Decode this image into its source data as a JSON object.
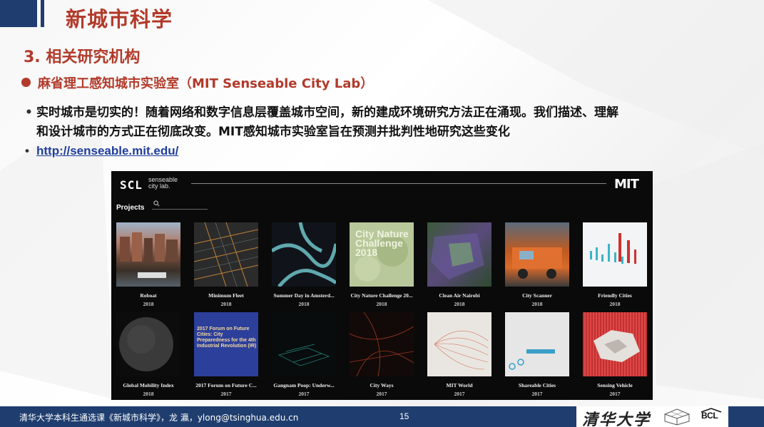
{
  "slide": {
    "title": "新城市科学",
    "section": "3. 相关研究机构",
    "subheading": "麻省理工感知城市实验室（MIT Senseable City Lab）",
    "bullet1_line1": "实时城市是切实的！随着网络和数字信息层覆盖城市空间，新的建成环境研究方法正在涌现。我们描述、理解",
    "bullet1_line2": "和设计城市的方式正在彻底改变。MIT感知城市实验室旨在预测并批判性地研究这些变化",
    "link": "http://senseable.mit.edu/",
    "bullet_mark": "•"
  },
  "embedded_site": {
    "logo": "SCL",
    "name_line1": "senseable",
    "name_line2": "city lab.",
    "mit_logo": "MIT",
    "projects_label": "Projects",
    "search_icon": "search-icon",
    "projects": [
      {
        "title": "Roboat",
        "year": "2018"
      },
      {
        "title": "Minimum Fleet",
        "year": "2018"
      },
      {
        "title": "Summer Day in Amsterd...",
        "year": "2018"
      },
      {
        "title": "City Nature Challenge 20...",
        "year": "2018",
        "thumb_text": "City Nature Challenge 2018"
      },
      {
        "title": "Clean Air Nairobi",
        "year": "2018"
      },
      {
        "title": "City Scanner",
        "year": "2018"
      },
      {
        "title": "Friendly Cities",
        "year": "2018"
      },
      {
        "title": "Global Mobility Index",
        "year": "2018"
      },
      {
        "title": "2017 Forum on Future C...",
        "year": "2017",
        "thumb_text": "2017 Forum on Future Cities: City Preparedness for the 4th Industrial Revolution (IR)"
      },
      {
        "title": "Gangnam Poop: Underw...",
        "year": "2017"
      },
      {
        "title": "City Ways",
        "year": "2017"
      },
      {
        "title": "MIT World",
        "year": "2017"
      },
      {
        "title": "Shareable Cities",
        "year": "2017"
      },
      {
        "title": "Sensing Vehicle",
        "year": "2017"
      }
    ]
  },
  "footer": {
    "text": "清华大学本科生通选课《新城市科学》，龙 瀛，ylong@tsinghua.edu.cn",
    "page": "15",
    "university_logo": "清华大学",
    "bcl_logo": "BCL"
  },
  "colors": {
    "accent_red": "#b23a2a",
    "navy": "#1f3d6e",
    "link_blue": "#1f3d9e"
  }
}
